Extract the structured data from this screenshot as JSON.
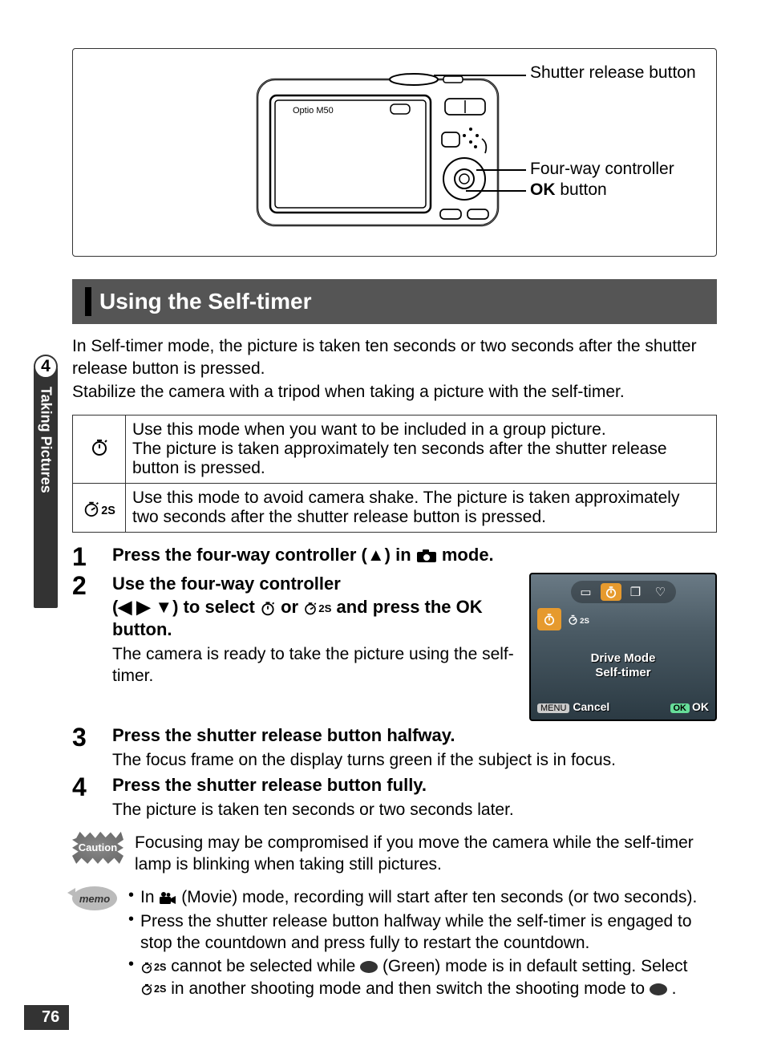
{
  "chapter_number": "4",
  "side_label": "Taking Pictures",
  "page_number": "76",
  "diagram": {
    "camera_model": "Optio M50",
    "callouts": {
      "shutter": "Shutter release button",
      "fourway": "Four-way controller",
      "ok_prefix": "OK",
      "ok_suffix": " button"
    }
  },
  "section_title": "Using the Self-timer",
  "intro": {
    "line1": "In Self-timer mode, the picture is taken ten seconds or two seconds after the shutter release button is pressed.",
    "line2": "Stabilize the camera with a tripod when taking a picture with the self-timer."
  },
  "modes": {
    "ten": "Use this mode when you want to be included in a group picture.\nThe picture is taken approximately ten seconds after the shutter release button is pressed.",
    "two": "Use this mode to avoid camera shake. The picture is taken approximately two seconds after the shutter release button is pressed."
  },
  "steps": {
    "s1": {
      "num": "1",
      "title_pre": "Press the four-way controller (",
      "title_mid": "▲",
      "title_post": ") in ",
      "title_end": " mode."
    },
    "s2": {
      "num": "2",
      "title_l1": "Use the four-way controller",
      "title_l2_pre": "(",
      "title_l2_arrows": "◀ ▶ ▼",
      "title_l2_mid1": ") to select ",
      "title_l2_or": " or ",
      "title_l2_mid2": " and press the ",
      "title_l2_ok": "OK",
      "title_l2_end": " button.",
      "desc": "The camera is ready to take the picture using the self-timer."
    },
    "s3": {
      "num": "3",
      "title": "Press the shutter release button halfway.",
      "desc": "The focus frame on the display turns green if the subject is in focus."
    },
    "s4": {
      "num": "4",
      "title": "Press the shutter release button fully.",
      "desc": "The picture is taken ten seconds or two seconds later."
    }
  },
  "lcd": {
    "mode_line1": "Drive Mode",
    "mode_line2": "Self-timer",
    "menu_label": "MENU",
    "cancel": "Cancel",
    "ok_tag": "OK",
    "ok_text": "OK"
  },
  "caution_label": "Caution",
  "caution_text": "Focusing may be compromised if you move the camera while the self-timer lamp is blinking when taking still pictures.",
  "memo_label": "memo",
  "memo": {
    "b1_pre": "In ",
    "b1_post": " (Movie) mode, recording will start after ten seconds (or two seconds).",
    "b2": "Press the shutter release button halfway while the self-timer is engaged to stop the countdown and press fully to restart the countdown.",
    "b3_pre": "",
    "b3_a": " cannot be selected while ",
    "b3_b": " (Green) mode is in default setting. Select ",
    "b3_c": " in another shooting mode and then switch the shooting mode to ",
    "b3_d": "."
  }
}
